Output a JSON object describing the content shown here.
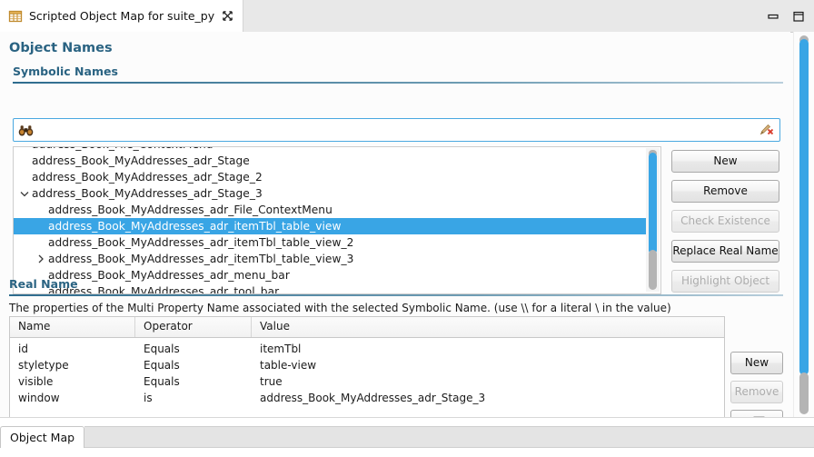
{
  "window": {
    "tab_title": "Scripted Object Map for suite_py",
    "tab_icon": "table-view-icon",
    "close_icon": "close-x-icon",
    "minimize_icon": "minimize-icon",
    "maximize_icon": "maximize-icon"
  },
  "object_names": {
    "title": "Object Names",
    "symbolic": {
      "title": "Symbolic Names",
      "search": {
        "value": "",
        "placeholder": "",
        "left_icon": "binoculars-search-icon",
        "right_icon": "broom-clear-icon"
      },
      "tree_items": [
        {
          "label": "address_Book_File_ContextMenu",
          "indent": 1,
          "arrow": "none",
          "selected": false,
          "clipped": true
        },
        {
          "label": "address_Book_MyAddresses_adr_Stage",
          "indent": 1,
          "arrow": "none",
          "selected": false,
          "clipped": false
        },
        {
          "label": "address_Book_MyAddresses_adr_Stage_2",
          "indent": 1,
          "arrow": "none",
          "selected": false,
          "clipped": false
        },
        {
          "label": "address_Book_MyAddresses_adr_Stage_3",
          "indent": 1,
          "arrow": "expanded",
          "selected": false,
          "clipped": false
        },
        {
          "label": "address_Book_MyAddresses_adr_File_ContextMenu",
          "indent": 2,
          "arrow": "none",
          "selected": false,
          "clipped": false
        },
        {
          "label": "address_Book_MyAddresses_adr_itemTbl_table_view",
          "indent": 2,
          "arrow": "none",
          "selected": true,
          "clipped": false
        },
        {
          "label": "address_Book_MyAddresses_adr_itemTbl_table_view_2",
          "indent": 2,
          "arrow": "none",
          "selected": false,
          "clipped": false
        },
        {
          "label": "address_Book_MyAddresses_adr_itemTbl_table_view_3",
          "indent": 2,
          "arrow": "collapsed",
          "selected": false,
          "clipped": false
        },
        {
          "label": "address_Book_MyAddresses_adr_menu_bar",
          "indent": 2,
          "arrow": "none",
          "selected": false,
          "clipped": false
        },
        {
          "label": "address_Book_MyAddresses_adr_tool_bar",
          "indent": 2,
          "arrow": "none",
          "selected": false,
          "clipped": true
        }
      ],
      "buttons": [
        {
          "label": "New",
          "enabled": true
        },
        {
          "label": "Remove",
          "enabled": true
        },
        {
          "label": "Check Existence",
          "enabled": false
        },
        {
          "label": "Replace Real Name",
          "enabled": true
        },
        {
          "label": "Highlight Object",
          "enabled": false
        }
      ]
    },
    "real_name": {
      "title": "Real Name",
      "description": "The properties of the Multi Property Name associated with the selected Symbolic Name. (use \\\\ for a literal \\ in the value)",
      "columns": [
        "Name",
        "Operator",
        "Value"
      ],
      "rows": [
        {
          "name": "id",
          "operator": "Equals",
          "value": "itemTbl"
        },
        {
          "name": "styletype",
          "operator": "Equals",
          "value": "table-view"
        },
        {
          "name": "visible",
          "operator": "Equals",
          "value": "true"
        },
        {
          "name": "window",
          "operator": "is",
          "value": "address_Book_MyAddresses_adr_Stage_3"
        }
      ],
      "buttons": [
        {
          "label": "New",
          "enabled": true
        },
        {
          "label": "Remove",
          "enabled": false
        }
      ],
      "pick_button": {
        "icon": "object-picker-icon",
        "enabled": true
      }
    }
  },
  "bottom_tabs": [
    {
      "label": "Object Map",
      "active": true
    }
  ],
  "colors": {
    "accent": "#39a5e5",
    "section_heading": "#2a6382",
    "selection": "#39a5e5",
    "panel_bg": "#fcfcfc"
  }
}
